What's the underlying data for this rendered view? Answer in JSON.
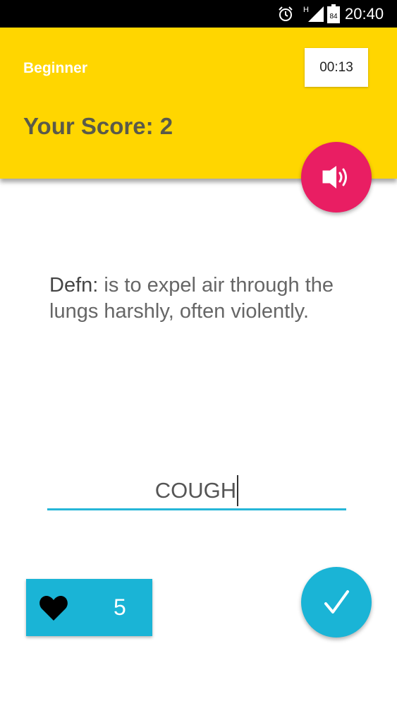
{
  "status_bar": {
    "time": "20:40",
    "network": "H",
    "battery": "84",
    "icons": [
      "alarm-icon",
      "signal-icon",
      "battery-icon"
    ]
  },
  "header": {
    "level": "Beginner",
    "timer": "00:13",
    "score_label": "Your Score: 2"
  },
  "speaker": {
    "icon": "speaker-icon"
  },
  "definition": {
    "label": "Defn:",
    "text": " is to expel air through the lungs harshly, often violently."
  },
  "answer": {
    "value": "COUGH"
  },
  "lives": {
    "icon": "heart-icon",
    "count": "5"
  },
  "submit": {
    "icon": "check-icon"
  },
  "colors": {
    "header_bg": "#FFD600",
    "speaker_fab": "#E91E63",
    "accent": "#1AB4D6",
    "status_bar": "#000000"
  }
}
